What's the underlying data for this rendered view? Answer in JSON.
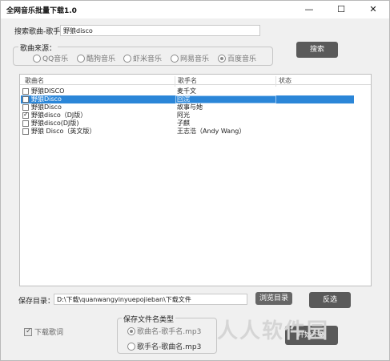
{
  "window": {
    "title": "全网音乐批量下载1.0",
    "minimize": "—",
    "maximize": "☐",
    "close": "✕"
  },
  "search": {
    "label": "搜索歌曲-歌手",
    "value": "野狼disco",
    "button": "搜索"
  },
  "source": {
    "legend": "歌曲来源：",
    "options": [
      {
        "label": "QQ音乐",
        "checked": false
      },
      {
        "label": "酷狗音乐",
        "checked": false
      },
      {
        "label": "虾米音乐",
        "checked": false
      },
      {
        "label": "网易音乐",
        "checked": false
      },
      {
        "label": "百度音乐",
        "checked": true
      }
    ]
  },
  "table": {
    "columns": [
      "歌曲名",
      "歌手名",
      "状态"
    ],
    "rows": [
      {
        "name": "野狼DISCO",
        "artist": "麦千文",
        "status": "",
        "checked": false,
        "selected": false
      },
      {
        "name": "野狼Disco",
        "artist": "回浣",
        "status": "",
        "checked": false,
        "selected": true
      },
      {
        "name": "野狼Disco",
        "artist": "故事与她",
        "status": "",
        "checked": false,
        "selected": false
      },
      {
        "name": "野狼disco（DJ版）",
        "artist": "阿光",
        "status": "",
        "checked": true,
        "selected": false
      },
      {
        "name": "野狼disco(DJ版)",
        "artist": "子麒",
        "status": "",
        "checked": false,
        "selected": false
      },
      {
        "name": "野狼 Disco（英文版）",
        "artist": "王志浩（Andy Wang）",
        "status": "",
        "checked": false,
        "selected": false
      }
    ]
  },
  "save": {
    "label": "保存目录：",
    "path": "D:\\下载\\quanwangyinyuepojieban\\下载文件",
    "browse_button": "浏览目录",
    "invert_button": "反选"
  },
  "lyrics": {
    "label": "下载歌词",
    "checked": true
  },
  "filename": {
    "legend": "保存文件名类型",
    "options": [
      {
        "label": "歌曲名-歌手名.mp3",
        "checked": true
      },
      {
        "label": "歌手名-歌曲名.mp3",
        "checked": false
      }
    ]
  },
  "download": {
    "button": "开始下载"
  },
  "watermark": "人人软件园"
}
